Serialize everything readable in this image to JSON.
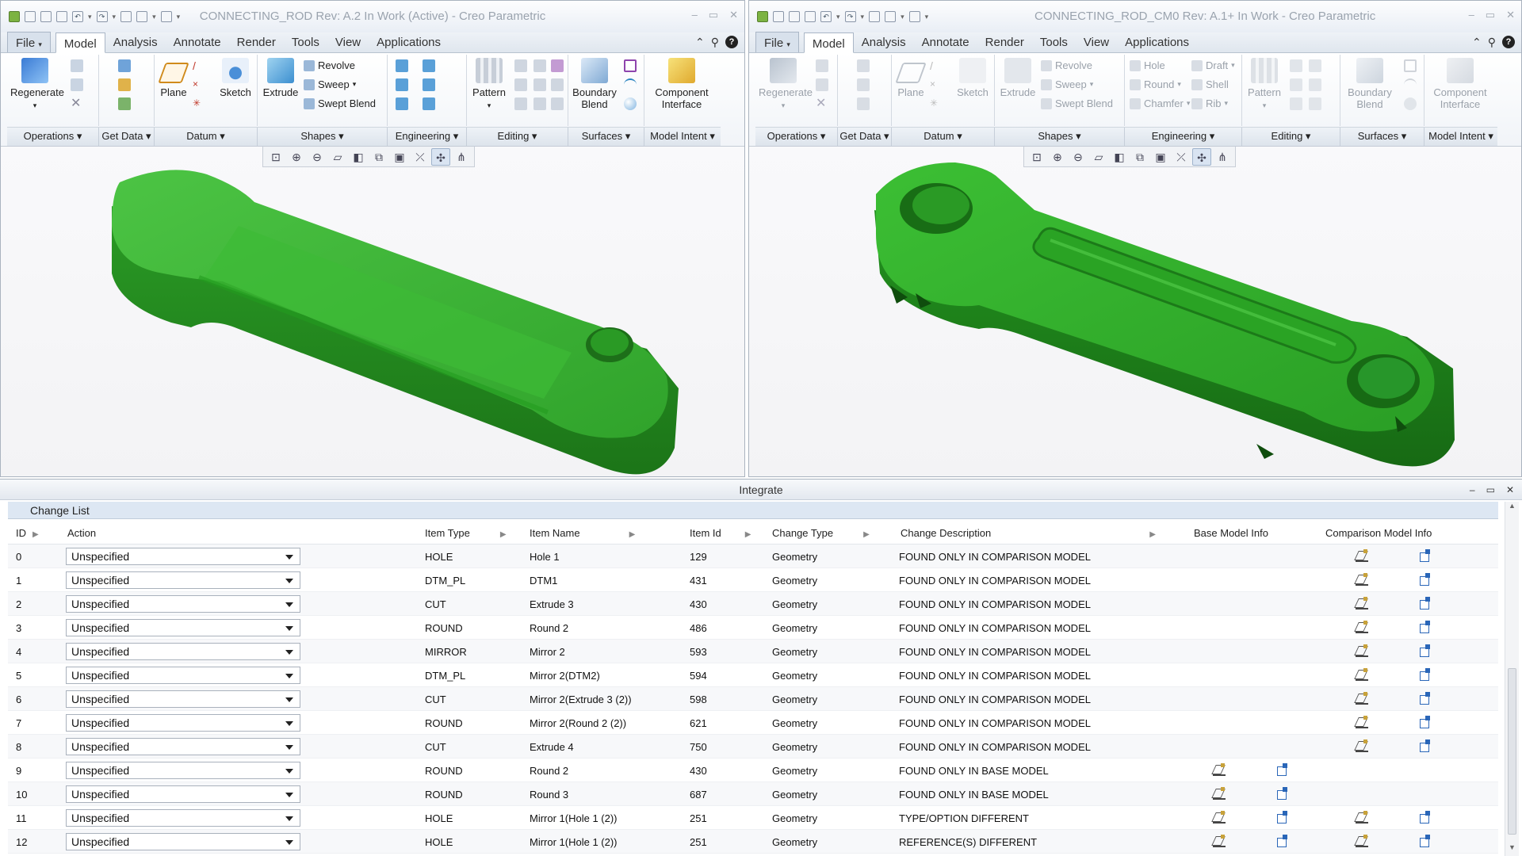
{
  "left_window": {
    "title": "CONNECTING_ROD Rev: A.2 In Work  (Active) - Creo Parametric",
    "tabs": [
      "File",
      "Model",
      "Analysis",
      "Annotate",
      "Render",
      "Tools",
      "View",
      "Applications"
    ],
    "active_tab": "Model",
    "buttons": {
      "regenerate": "Regenerate",
      "plane": "Plane",
      "sketch": "Sketch",
      "extrude": "Extrude",
      "revolve": "Revolve",
      "sweep": "Sweep",
      "swept_blend": "Swept Blend",
      "pattern": "Pattern",
      "boundary_blend_1": "Boundary",
      "boundary_blend_2": "Blend",
      "component_interface_1": "Component",
      "component_interface_2": "Interface"
    },
    "groups": [
      "Operations",
      "Get Data",
      "Datum",
      "Shapes",
      "Engineering",
      "Editing",
      "Surfaces",
      "Model Intent"
    ]
  },
  "right_window": {
    "title": "CONNECTING_ROD_CM0 Rev: A.1+ In Work  - Creo Parametric",
    "tabs": [
      "File",
      "Model",
      "Analysis",
      "Annotate",
      "Render",
      "Tools",
      "View",
      "Applications"
    ],
    "active_tab": "Model",
    "buttons": {
      "regenerate": "Regenerate",
      "plane": "Plane",
      "sketch": "Sketch",
      "extrude": "Extrude",
      "revolve": "Revolve",
      "sweep": "Sweep",
      "swept_blend": "Swept Blend",
      "hole": "Hole",
      "round": "Round",
      "chamfer": "Chamfer",
      "draft": "Draft",
      "shell": "Shell",
      "rib": "Rib",
      "pattern": "Pattern",
      "boundary_blend_1": "Boundary",
      "boundary_blend_2": "Blend",
      "component_interface_1": "Component",
      "component_interface_2": "Interface"
    },
    "groups": [
      "Operations",
      "Get Data",
      "Datum",
      "Shapes",
      "Engineering",
      "Editing",
      "Surfaces",
      "Model Intent"
    ]
  },
  "integrate": {
    "title": "Integrate",
    "section": "Change List",
    "columns": [
      "ID",
      "Action",
      "Item Type",
      "Item Name",
      "Item Id",
      "Change Type",
      "Change Description",
      "Base Model Info",
      "Comparison Model Info"
    ],
    "rows": [
      {
        "id": "0",
        "action": "Unspecified",
        "type": "HOLE",
        "name": "Hole 1",
        "item_id": "129",
        "change": "Geometry",
        "desc": "FOUND ONLY IN COMPARISON MODEL",
        "base": false,
        "comp": true
      },
      {
        "id": "1",
        "action": "Unspecified",
        "type": "DTM_PL",
        "name": "DTM1",
        "item_id": "431",
        "change": "Geometry",
        "desc": "FOUND ONLY IN COMPARISON MODEL",
        "base": false,
        "comp": true
      },
      {
        "id": "2",
        "action": "Unspecified",
        "type": "CUT",
        "name": "Extrude 3",
        "item_id": "430",
        "change": "Geometry",
        "desc": "FOUND ONLY IN COMPARISON MODEL",
        "base": false,
        "comp": true
      },
      {
        "id": "3",
        "action": "Unspecified",
        "type": "ROUND",
        "name": "Round 2",
        "item_id": "486",
        "change": "Geometry",
        "desc": "FOUND ONLY IN COMPARISON MODEL",
        "base": false,
        "comp": true
      },
      {
        "id": "4",
        "action": "Unspecified",
        "type": "MIRROR",
        "name": "Mirror 2",
        "item_id": "593",
        "change": "Geometry",
        "desc": "FOUND ONLY IN COMPARISON MODEL",
        "base": false,
        "comp": true
      },
      {
        "id": "5",
        "action": "Unspecified",
        "type": "DTM_PL",
        "name": "Mirror 2(DTM2)",
        "item_id": "594",
        "change": "Geometry",
        "desc": "FOUND ONLY IN COMPARISON MODEL",
        "base": false,
        "comp": true
      },
      {
        "id": "6",
        "action": "Unspecified",
        "type": "CUT",
        "name": "Mirror 2(Extrude 3 (2))",
        "item_id": "598",
        "change": "Geometry",
        "desc": "FOUND ONLY IN COMPARISON MODEL",
        "base": false,
        "comp": true
      },
      {
        "id": "7",
        "action": "Unspecified",
        "type": "ROUND",
        "name": "Mirror 2(Round 2 (2))",
        "item_id": "621",
        "change": "Geometry",
        "desc": "FOUND ONLY IN COMPARISON MODEL",
        "base": false,
        "comp": true
      },
      {
        "id": "8",
        "action": "Unspecified",
        "type": "CUT",
        "name": "Extrude 4",
        "item_id": "750",
        "change": "Geometry",
        "desc": "FOUND ONLY IN COMPARISON MODEL",
        "base": false,
        "comp": true
      },
      {
        "id": "9",
        "action": "Unspecified",
        "type": "ROUND",
        "name": "Round 2",
        "item_id": "430",
        "change": "Geometry",
        "desc": "FOUND ONLY IN BASE MODEL",
        "base": true,
        "comp": false
      },
      {
        "id": "10",
        "action": "Unspecified",
        "type": "ROUND",
        "name": "Round 3",
        "item_id": "687",
        "change": "Geometry",
        "desc": "FOUND ONLY IN BASE MODEL",
        "base": true,
        "comp": false
      },
      {
        "id": "11",
        "action": "Unspecified",
        "type": "HOLE",
        "name": "Mirror 1(Hole 1 (2))",
        "item_id": "251",
        "change": "Geometry",
        "desc": "TYPE/OPTION DIFFERENT",
        "base": true,
        "comp": true
      },
      {
        "id": "12",
        "action": "Unspecified",
        "type": "HOLE",
        "name": "Mirror 1(Hole 1 (2))",
        "item_id": "251",
        "change": "Geometry",
        "desc": "REFERENCE(S) DIFFERENT",
        "base": true,
        "comp": true
      }
    ]
  },
  "colors": {
    "model_green": "#2fa52a",
    "model_green_dark": "#1e7a1a",
    "accent": "#2a66b8"
  }
}
